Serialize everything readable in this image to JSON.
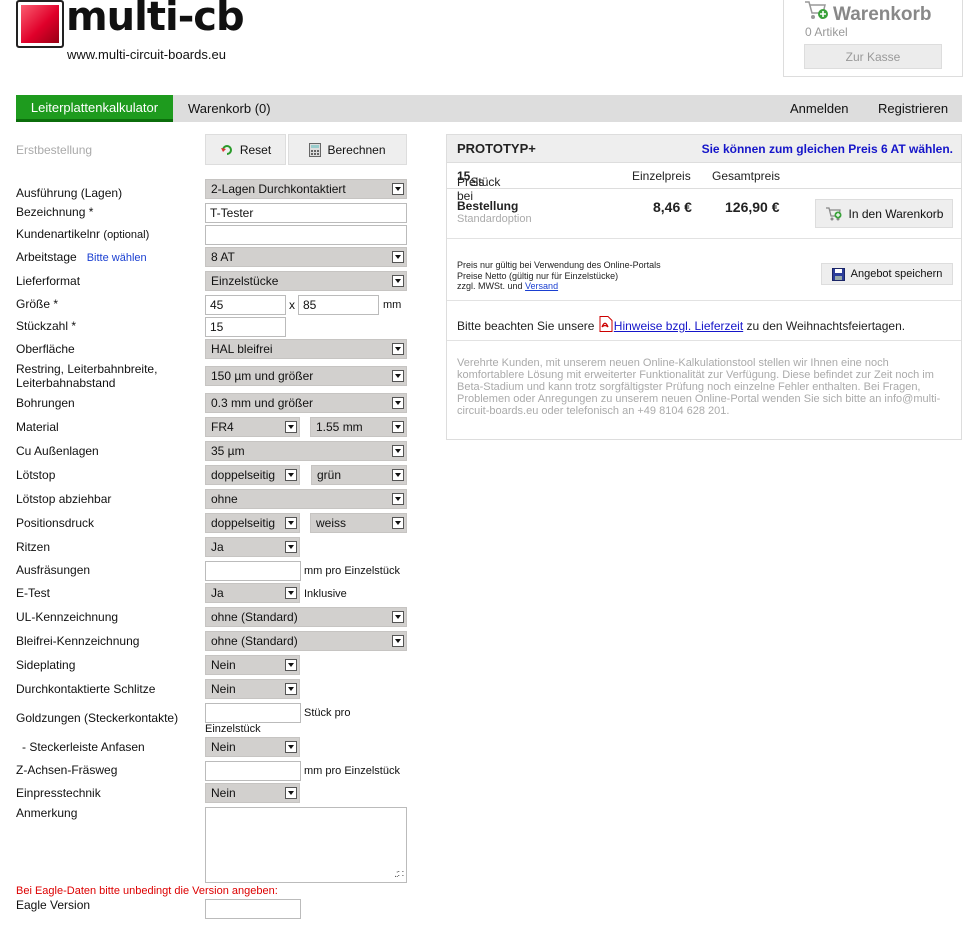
{
  "logo": {
    "text": "multi-cb",
    "url": "www.multi-circuit-boards.eu"
  },
  "cart": {
    "title": "Warenkorb",
    "count": "0 Artikel",
    "checkout": "Zur Kasse"
  },
  "nav": {
    "calculator": "Leiterplattenkalkulator",
    "cart": "Warenkorb (0)",
    "login": "Anmelden",
    "register": "Registrieren"
  },
  "form": {
    "first_order": "Erstbestellung",
    "reset": "Reset",
    "calculate": "Berechnen",
    "layers": {
      "label": "Ausführung (Lagen)",
      "value": "2-Lagen Durchkontaktiert"
    },
    "name": {
      "label": "Bezeichnung *",
      "value": "T-Tester"
    },
    "article": {
      "label": "Kundenartikelnr",
      "label_hint": "(optional)",
      "value": ""
    },
    "workdays": {
      "label": "Arbeitstage",
      "link": "Bitte wählen",
      "value": "8 AT"
    },
    "delivery_format": {
      "label": "Lieferformat",
      "value": "Einzelstücke"
    },
    "size": {
      "label": "Größe *",
      "width": "45",
      "sep": "x",
      "height": "85",
      "unit": "mm"
    },
    "quantity": {
      "label": "Stückzahl *",
      "value": "15"
    },
    "surface": {
      "label": "Oberfläche",
      "value": "HAL bleifrei"
    },
    "restring": {
      "label_1": "Restring, Leiterbahnbreite,",
      "label_2": "Leiterbahnabstand",
      "value": "150 µm und größer"
    },
    "drills": {
      "label": "Bohrungen",
      "value": "0.3 mm und größer"
    },
    "material": {
      "label": "Material",
      "value": "FR4",
      "thickness": "1.55 mm"
    },
    "cu_outer": {
      "label": "Cu Außenlagen",
      "value": "35 µm"
    },
    "soldermask": {
      "label": "Lötstop",
      "value": "doppelseitig",
      "color": "grün"
    },
    "peelable": {
      "label": "Lötstop abziehbar",
      "value": "ohne"
    },
    "silkscreen": {
      "label": "Positionsdruck",
      "value": "doppelseitig",
      "color": "weiss"
    },
    "scoring": {
      "label": "Ritzen",
      "value": "Ja"
    },
    "milling": {
      "label": "Ausfräsungen",
      "value": "",
      "unit": "mm pro Einzelstück"
    },
    "etest": {
      "label": "E-Test",
      "value": "Ja",
      "note": "Inklusive"
    },
    "ul": {
      "label": "UL-Kennzeichnung",
      "value": "ohne (Standard)"
    },
    "leadfree": {
      "label": "Bleifrei-Kennzeichnung",
      "value": "ohne (Standard)"
    },
    "sideplating": {
      "label": "Sideplating",
      "value": "Nein"
    },
    "slots": {
      "label": "Durchkontaktierte Schlitze",
      "value": "Nein"
    },
    "gold": {
      "label": "Goldzungen (Steckerkontakte)",
      "value": "",
      "unit_1": "Stück pro",
      "unit_2": "Einzelstück"
    },
    "chamfer": {
      "label": "- Steckerleiste Anfasen",
      "value": "Nein"
    },
    "zaxis": {
      "label": "Z-Achsen-Fräsweg",
      "value": "",
      "unit": "mm pro Einzelstück"
    },
    "pressfit": {
      "label": "Einpresstechnik",
      "value": "Nein"
    },
    "remark": {
      "label": "Anmerkung"
    },
    "eagle_warning": "Bei Eagle-Daten bitte unbedingt die Version angeben:",
    "eagle": {
      "label": "Eagle Version",
      "value": ""
    }
  },
  "panel": {
    "title": "PROTOTYP+",
    "promo": "Sie können zum gleichen Preis 6 AT wählen.",
    "price_for_pre": "Preis bei",
    "price_for_qty": "15",
    "price_for_post": "Stück",
    "col_unit": "Einzelpreis",
    "col_total": "Gesamtpreis",
    "order_title": "Bestellung",
    "order_sub": "Standardoption",
    "unit_price": "8,46 €",
    "total_price": "126,90 €",
    "add_to_cart": "In den Warenkorb",
    "note_1": "Preis nur gültig bei Verwendung des Online-Portals",
    "note_2": "Preise Netto (gültig nur für Einzelstücke)",
    "note_3": "zzgl. MWSt. und",
    "note_link": "Versand",
    "save_offer": "Angebot speichern",
    "notice_pre": "Bitte beachten Sie unsere",
    "notice_link": "Hinweise bzgl. Lieferzeit",
    "notice_post": "zu den Weihnachtsfeiertagen.",
    "beta_text": "Verehrte Kunden, mit unserem neuen Online-Kalkulationstool stellen wir Ihnen eine noch komfortablere Lösung mit erweiterter Funktionalität zur Verfügung. Diese befindet zur Zeit noch im Beta-Stadium und kann trotz sorgfältigster Prüfung noch einzelne Fehler enthalten. Bei Fragen, Problemen oder Anregungen zu unserem neuen Online-Portal wenden Sie sich bitte an info@multi-circuit-boards.eu oder telefonisch an +49 8104 628 201."
  }
}
